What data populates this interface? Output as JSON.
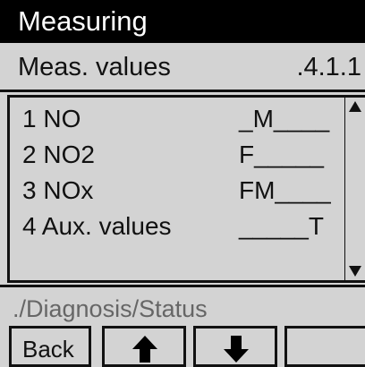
{
  "titlebar": {
    "title": "Measuring"
  },
  "subbar": {
    "label": "Meas. values",
    "index": ".4.1.1"
  },
  "list": {
    "items": [
      {
        "label": "1 NO",
        "status": "_M____"
      },
      {
        "label": "2 NO2",
        "status": "F_____"
      },
      {
        "label": "3 NOx",
        "status": "FM____"
      },
      {
        "label": "4 Aux. values",
        "status": "_____T"
      }
    ]
  },
  "scrollbar": {
    "up_icon": "triangle-up",
    "down_icon": "triangle-down"
  },
  "path": {
    "text": "./Diagnosis/Status"
  },
  "softkeys": {
    "back_label": "Back",
    "up_icon": "arrow-up",
    "down_icon": "arrow-down"
  }
}
